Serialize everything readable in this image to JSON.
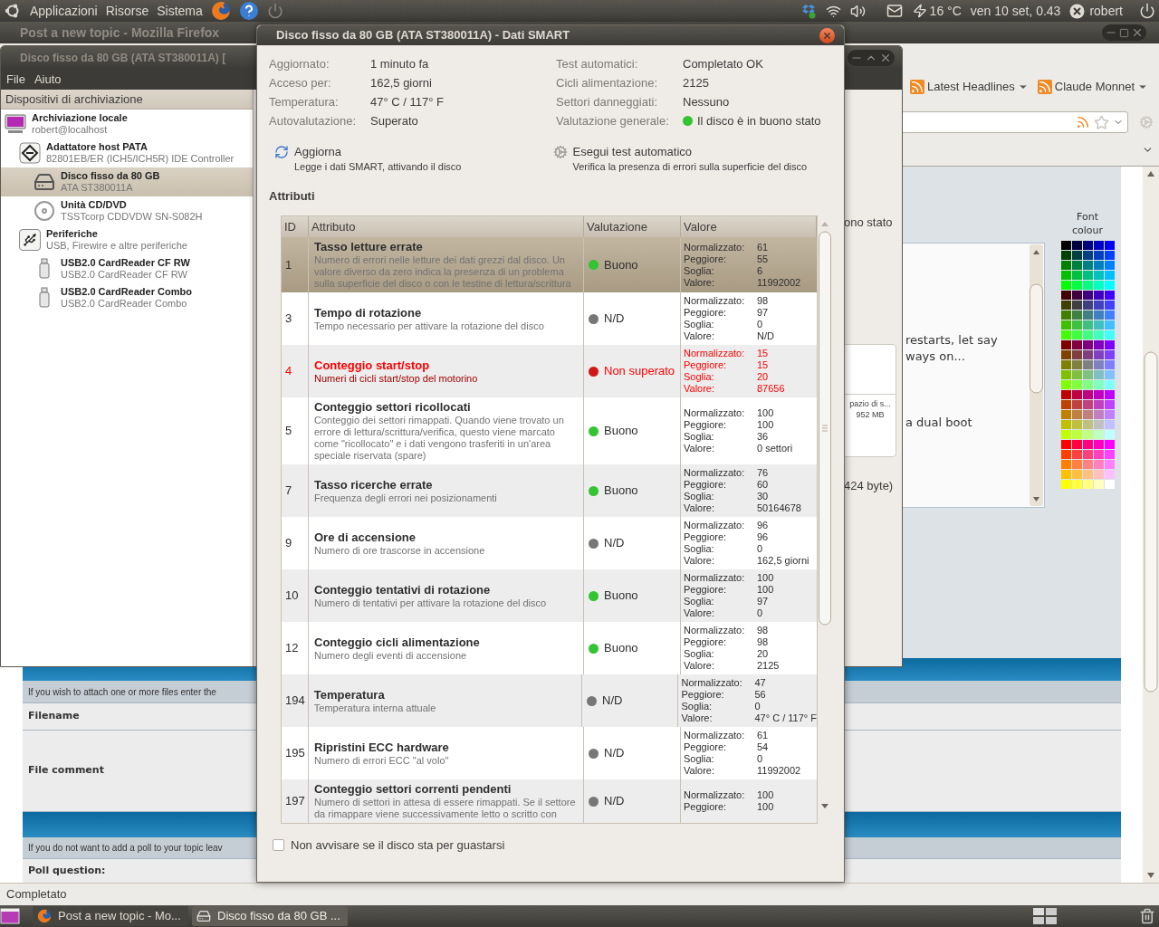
{
  "top_panel": {
    "menus": [
      "Applicazioni",
      "Risorse",
      "Sistema"
    ],
    "weather": "16 °C",
    "clock": "ven 10 set, 0.43",
    "user": "robert"
  },
  "firefox": {
    "title": "Post a new topic - Mozilla Firefox",
    "bookmarks": [
      "Latest Headlines",
      "Claude Monnet"
    ],
    "editor": {
      "fragments": [
        "restarts, let say",
        "ways on...",
        "a dual boot"
      ],
      "palette_label": "Font colour",
      "palette": [
        [
          {
            "color": "#000000"
          },
          {
            "color": "#000040"
          },
          {
            "color": "#000080"
          },
          {
            "color": "#0000c0"
          },
          {
            "color": "#0000ff"
          }
        ],
        [
          {
            "color": "#004000"
          },
          {
            "color": "#004040"
          },
          {
            "color": "#004080"
          },
          {
            "color": "#0040c0"
          },
          {
            "color": "#0040ff"
          }
        ],
        [
          {
            "color": "#008000"
          },
          {
            "color": "#008040"
          },
          {
            "color": "#008080"
          },
          {
            "color": "#0080c0"
          },
          {
            "color": "#0080ff"
          }
        ],
        [
          {
            "color": "#00c000"
          },
          {
            "color": "#00c040"
          },
          {
            "color": "#00c080"
          },
          {
            "color": "#00c0c0"
          },
          {
            "color": "#00c0ff"
          }
        ],
        [
          {
            "color": "#00ff00"
          },
          {
            "color": "#00ff40"
          },
          {
            "color": "#00ff80"
          },
          {
            "color": "#00ffc0"
          },
          {
            "color": "#00ffff"
          }
        ],
        [
          {
            "color": "#400000"
          },
          {
            "color": "#400040"
          },
          {
            "color": "#400080"
          },
          {
            "color": "#4000c0"
          },
          {
            "color": "#4000ff"
          }
        ],
        [
          {
            "color": "#404000"
          },
          {
            "color": "#404040"
          },
          {
            "color": "#404080"
          },
          {
            "color": "#4040c0"
          },
          {
            "color": "#4040ff"
          }
        ],
        [
          {
            "color": "#408000"
          },
          {
            "color": "#408040"
          },
          {
            "color": "#408080"
          },
          {
            "color": "#4080c0"
          },
          {
            "color": "#4080ff"
          }
        ],
        [
          {
            "color": "#40c000"
          },
          {
            "color": "#40c040"
          },
          {
            "color": "#40c080"
          },
          {
            "color": "#40c0c0"
          },
          {
            "color": "#40c0ff"
          }
        ],
        [
          {
            "color": "#40ff00"
          },
          {
            "color": "#40ff40"
          },
          {
            "color": "#40ff80"
          },
          {
            "color": "#40ffc0"
          },
          {
            "color": "#40ffff"
          }
        ],
        [
          {
            "color": "#800000"
          },
          {
            "color": "#800040"
          },
          {
            "color": "#800080"
          },
          {
            "color": "#8000c0"
          },
          {
            "color": "#8000ff"
          }
        ],
        [
          {
            "color": "#804000"
          },
          {
            "color": "#804040"
          },
          {
            "color": "#804080"
          },
          {
            "color": "#8040c0"
          },
          {
            "color": "#8040ff"
          }
        ],
        [
          {
            "color": "#808000"
          },
          {
            "color": "#808040"
          },
          {
            "color": "#808080"
          },
          {
            "color": "#8080c0"
          },
          {
            "color": "#8080ff"
          }
        ],
        [
          {
            "color": "#80c000"
          },
          {
            "color": "#80c040"
          },
          {
            "color": "#80c080"
          },
          {
            "color": "#80c0c0"
          },
          {
            "color": "#80c0ff"
          }
        ],
        [
          {
            "color": "#80ff00"
          },
          {
            "color": "#80ff40"
          },
          {
            "color": "#80ff80"
          },
          {
            "color": "#80ffc0"
          },
          {
            "color": "#80ffff"
          }
        ],
        [
          {
            "color": "#c00000"
          },
          {
            "color": "#c00040"
          },
          {
            "color": "#c00080"
          },
          {
            "color": "#c000c0"
          },
          {
            "color": "#c000ff"
          }
        ],
        [
          {
            "color": "#c04000"
          },
          {
            "color": "#c04040"
          },
          {
            "color": "#c04080"
          },
          {
            "color": "#c040c0"
          },
          {
            "color": "#c040ff"
          }
        ],
        [
          {
            "color": "#c08000"
          },
          {
            "color": "#c08040"
          },
          {
            "color": "#c08080"
          },
          {
            "color": "#c080c0"
          },
          {
            "color": "#c080ff"
          }
        ],
        [
          {
            "color": "#c0c000"
          },
          {
            "color": "#c0c040"
          },
          {
            "color": "#c0c080"
          },
          {
            "color": "#c0c0c0"
          },
          {
            "color": "#c0c0ff"
          }
        ],
        [
          {
            "color": "#c0ff00"
          },
          {
            "color": "#c0ff40"
          },
          {
            "color": "#c0ff80"
          },
          {
            "color": "#c0ffc0"
          },
          {
            "color": "#c0ffff"
          }
        ],
        [
          {
            "color": "#ff0000"
          },
          {
            "color": "#ff0040"
          },
          {
            "color": "#ff0080"
          },
          {
            "color": "#ff00c0"
          },
          {
            "color": "#ff00ff"
          }
        ],
        [
          {
            "color": "#ff4000"
          },
          {
            "color": "#ff4040"
          },
          {
            "color": "#ff4080"
          },
          {
            "color": "#ff40c0"
          },
          {
            "color": "#ff40ff"
          }
        ],
        [
          {
            "color": "#ff8000"
          },
          {
            "color": "#ff8040"
          },
          {
            "color": "#ff8080"
          },
          {
            "color": "#ff80c0"
          },
          {
            "color": "#ff80ff"
          }
        ],
        [
          {
            "color": "#ffc000"
          },
          {
            "color": "#ffc040"
          },
          {
            "color": "#ffc080"
          },
          {
            "color": "#ffc0c0"
          },
          {
            "color": "#ffc0ff"
          }
        ],
        [
          {
            "color": "#ffff00"
          },
          {
            "color": "#ffff40"
          },
          {
            "color": "#ffff80"
          },
          {
            "color": "#ffffc0"
          },
          {
            "color": "#ffffff"
          }
        ]
      ]
    },
    "forum": {
      "attach_hint": "If you wish to attach one or more files enter the",
      "filename_label": "Filename",
      "comment_label": "File comment",
      "poll_hint": "If you do not want to add a poll to your topic leav",
      "poll_question_label": "Poll question:"
    },
    "status": "Completato"
  },
  "disk_utility": {
    "title": "Disco fisso da 80 GB (ATA ST380011A) [",
    "menu": [
      "File",
      "Aiuto"
    ],
    "sidebar": {
      "header": "Dispositivi di archiviazione",
      "items": [
        {
          "kind": "computer",
          "title": "Archiviazione locale",
          "subtitle": "robert@localhost",
          "selected": false,
          "children": [
            {
              "kind": "controller",
              "title": "Adattatore host PATA",
              "subtitle": "82801EB/ER (ICH5/ICH5R) IDE Controller",
              "selected": false,
              "children": [
                {
                  "kind": "hdd",
                  "title": "Disco fisso da 80 GB",
                  "subtitle": "ATA ST380011A",
                  "selected": true
                },
                {
                  "kind": "optical",
                  "title": "Unità CD/DVD",
                  "subtitle": "TSSTcorp CDDVDW SN-S082H",
                  "selected": false
                }
              ]
            },
            {
              "kind": "hub",
              "title": "Periferiche",
              "subtitle": "USB, Firewire e altre periferiche",
              "selected": false,
              "children": [
                {
                  "kind": "usb",
                  "title": "USB2.0 CardReader CF RW",
                  "subtitle": "USB2.0 CardReader CF RW",
                  "selected": false
                },
                {
                  "kind": "usb",
                  "title": "USB2.0 CardReader Combo",
                  "subtitle": "USB2.0 CardReader Combo",
                  "selected": false
                }
              ]
            }
          ]
        }
      ]
    },
    "pane": {
      "status_fragment": "ono stato",
      "volume_name": "pazio di s...",
      "volume_size": "952 MB",
      "size_fragment": "424 byte)"
    }
  },
  "smart_dialog": {
    "title": "Disco fisso da 80 GB (ATA ST380011A) - Dati SMART",
    "summary_left": [
      {
        "label": "Aggiornato:",
        "value": "1 minuto fa"
      },
      {
        "label": "Acceso per:",
        "value": "162,5 giorni"
      },
      {
        "label": "Temperatura:",
        "value": "47° C / 117° F"
      },
      {
        "label": "Autovalutazione:",
        "value": "Superato"
      }
    ],
    "summary_right": [
      {
        "label": "Test automatici:",
        "value": "Completato OK"
      },
      {
        "label": "Cicli alimentazione:",
        "value": "2125"
      },
      {
        "label": "Settori danneggiati:",
        "value": "Nessuno"
      },
      {
        "label": "Valutazione generale:",
        "value": "Il disco è in buono stato",
        "color": "#33c333"
      }
    ],
    "actions": [
      {
        "kind": "refresh",
        "title": "Aggiorna",
        "description": "Legge i dati SMART, attivando il disco"
      },
      {
        "kind": "selftest",
        "title": "Esegui test automatico",
        "description": "Verifica la presenza di errori sulla superficie del disco"
      }
    ],
    "attributes_heading": "Attributi",
    "columns": [
      "ID",
      "Attributo",
      "Valutazione",
      "Valore"
    ],
    "rows": [
      {
        "id": "1",
        "name": "Tasso letture errate",
        "description": "Numero di errori nelle letture dei dati grezzi dal disco. Un valore diverso da zero indica la presenza di un problema sulla superficie del disco o con le testine di lettura/scrittura",
        "assessment": "Buono",
        "color": "#33c333",
        "failed": false,
        "selected": true,
        "values": [
          {
            "label": "Normalizzato:",
            "value": "61"
          },
          {
            "label": "Peggiore:",
            "value": "55"
          },
          {
            "label": "Soglia:",
            "value": "6"
          },
          {
            "label": "Valore:",
            "value": "11992002"
          }
        ]
      },
      {
        "id": "3",
        "name": "Tempo di rotazione",
        "description": "Tempo necessario per attivare la rotazione del disco",
        "assessment": "N/D",
        "color": "#777777",
        "failed": false,
        "selected": false,
        "values": [
          {
            "label": "Normalizzato:",
            "value": "98"
          },
          {
            "label": "Peggiore:",
            "value": "97"
          },
          {
            "label": "Soglia:",
            "value": "0"
          },
          {
            "label": "Valore:",
            "value": "N/D"
          }
        ]
      },
      {
        "id": "4",
        "name": "Conteggio start/stop",
        "description": "Numeri di cicli start/stop del motorino",
        "assessment": "Non superato",
        "color": "#d01818",
        "failed": true,
        "selected": false,
        "values": [
          {
            "label": "Normalizzato:",
            "value": "15"
          },
          {
            "label": "Peggiore:",
            "value": "15"
          },
          {
            "label": "Soglia:",
            "value": "20"
          },
          {
            "label": "Valore:",
            "value": "87656"
          }
        ]
      },
      {
        "id": "5",
        "name": "Conteggio settori ricollocati",
        "description": "Conteggio dei settori rimappati. Quando viene trovato un errore di lettura/scrittura/verifica, questo viene marcato come \"ricollocato\" e i dati vengono trasferiti in un'area speciale riservata (spare)",
        "assessment": "Buono",
        "color": "#33c333",
        "failed": false,
        "selected": false,
        "values": [
          {
            "label": "Normalizzato:",
            "value": "100"
          },
          {
            "label": "Peggiore:",
            "value": "100"
          },
          {
            "label": "Soglia:",
            "value": "36"
          },
          {
            "label": "Valore:",
            "value": "0 settori"
          }
        ]
      },
      {
        "id": "7",
        "name": "Tasso ricerche errate",
        "description": "Frequenza degli errori nei posizionamenti",
        "assessment": "Buono",
        "color": "#33c333",
        "failed": false,
        "selected": false,
        "values": [
          {
            "label": "Normalizzato:",
            "value": "76"
          },
          {
            "label": "Peggiore:",
            "value": "60"
          },
          {
            "label": "Soglia:",
            "value": "30"
          },
          {
            "label": "Valore:",
            "value": "50164678"
          }
        ]
      },
      {
        "id": "9",
        "name": "Ore di accensione",
        "description": "Numero di ore trascorse in accensione",
        "assessment": "N/D",
        "color": "#777777",
        "failed": false,
        "selected": false,
        "values": [
          {
            "label": "Normalizzato:",
            "value": "96"
          },
          {
            "label": "Peggiore:",
            "value": "96"
          },
          {
            "label": "Soglia:",
            "value": "0"
          },
          {
            "label": "Valore:",
            "value": "162,5 giorni"
          }
        ]
      },
      {
        "id": "10",
        "name": "Conteggio tentativi di rotazione",
        "description": "Numero di tentativi per attivare la rotazione del disco",
        "assessment": "Buono",
        "color": "#33c333",
        "failed": false,
        "selected": false,
        "values": [
          {
            "label": "Normalizzato:",
            "value": "100"
          },
          {
            "label": "Peggiore:",
            "value": "100"
          },
          {
            "label": "Soglia:",
            "value": "97"
          },
          {
            "label": "Valore:",
            "value": "0"
          }
        ]
      },
      {
        "id": "12",
        "name": "Conteggio cicli alimentazione",
        "description": "Numero degli eventi di accensione",
        "assessment": "Buono",
        "color": "#33c333",
        "failed": false,
        "selected": false,
        "values": [
          {
            "label": "Normalizzato:",
            "value": "98"
          },
          {
            "label": "Peggiore:",
            "value": "98"
          },
          {
            "label": "Soglia:",
            "value": "20"
          },
          {
            "label": "Valore:",
            "value": "2125"
          }
        ]
      },
      {
        "id": "194",
        "name": "Temperatura",
        "description": "Temperatura interna attuale",
        "assessment": "N/D",
        "color": "#777777",
        "failed": false,
        "selected": false,
        "values": [
          {
            "label": "Normalizzato:",
            "value": "47"
          },
          {
            "label": "Peggiore:",
            "value": "56"
          },
          {
            "label": "Soglia:",
            "value": "0"
          },
          {
            "label": "Valore:",
            "value": "47° C / 117° F"
          }
        ]
      },
      {
        "id": "195",
        "name": "Ripristini ECC hardware",
        "description": "Numero di errori ECC \"al volo\"",
        "assessment": "N/D",
        "color": "#777777",
        "failed": false,
        "selected": false,
        "values": [
          {
            "label": "Normalizzato:",
            "value": "61"
          },
          {
            "label": "Peggiore:",
            "value": "54"
          },
          {
            "label": "Soglia:",
            "value": "0"
          },
          {
            "label": "Valore:",
            "value": "11992002"
          }
        ]
      },
      {
        "id": "197",
        "name": "Conteggio settori correnti pendenti",
        "description": "Numero di settori in attesa di essere rimappati. Se il settore da rimappare viene successivamente letto o scritto con",
        "assessment": "N/D",
        "color": "#777777",
        "failed": false,
        "selected": false,
        "values": [
          {
            "label": "Normalizzato:",
            "value": "100"
          },
          {
            "label": "Peggiore:",
            "value": "100"
          }
        ]
      }
    ],
    "dont_warn": {
      "label": "Non avvisare se il disco sta per guastarsi",
      "checked": false
    }
  },
  "taskbar": {
    "tasks": [
      {
        "kind": "browser",
        "label": "Post a new topic - Mo...",
        "selected": false
      },
      {
        "kind": "disk",
        "label": "Disco fisso da 80 GB ...",
        "selected": true
      }
    ]
  }
}
